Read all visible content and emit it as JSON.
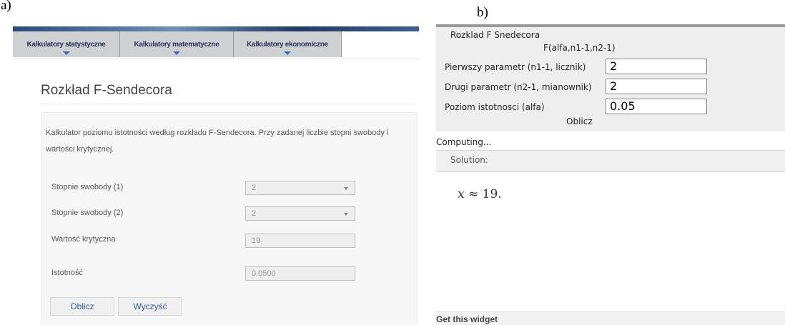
{
  "panel_labels": {
    "a": "a)",
    "b": "b)"
  },
  "panel_a": {
    "nav": [
      "Kalkulatory statystyczne",
      "Kalkulatory matematyczne",
      "Kalkulatory ekonomiczne"
    ],
    "title": "Rozkład F-Sendecora",
    "description": "Kalkulator poziomu istotności według rozkładu F-Sendecora. Przy zadanej liczbie stopni swobody i wartości krytycznej.",
    "fields": [
      {
        "label": "Stopnie swobody (1)",
        "value": "2"
      },
      {
        "label": "Stopnie swobody (2)",
        "value": "2"
      },
      {
        "label": "Wartość krytyczna",
        "value": "19"
      },
      {
        "label": "Istotność",
        "value": "0.0500"
      }
    ],
    "buttons": {
      "compute": "Oblicz",
      "clear": "Wyczyść"
    }
  },
  "panel_b": {
    "heading": "Rozklad F Snedecora",
    "formula": "F(alfa,n1-1,n2-1)",
    "rows": [
      {
        "label": "Pierwszy parametr (n1-1, licznik)",
        "value": "2"
      },
      {
        "label": "Drugi parametr (n2-1, mianownik)",
        "value": "2"
      },
      {
        "label": "Poziom istotnosci (alfa)",
        "value": "0.05"
      }
    ],
    "compute_label": "Oblicz",
    "computing_text": "Computing...",
    "solution_label": "Solution:",
    "result_var": "x",
    "result_rest": " ≈ 19.",
    "footer": "Get this widget"
  }
}
